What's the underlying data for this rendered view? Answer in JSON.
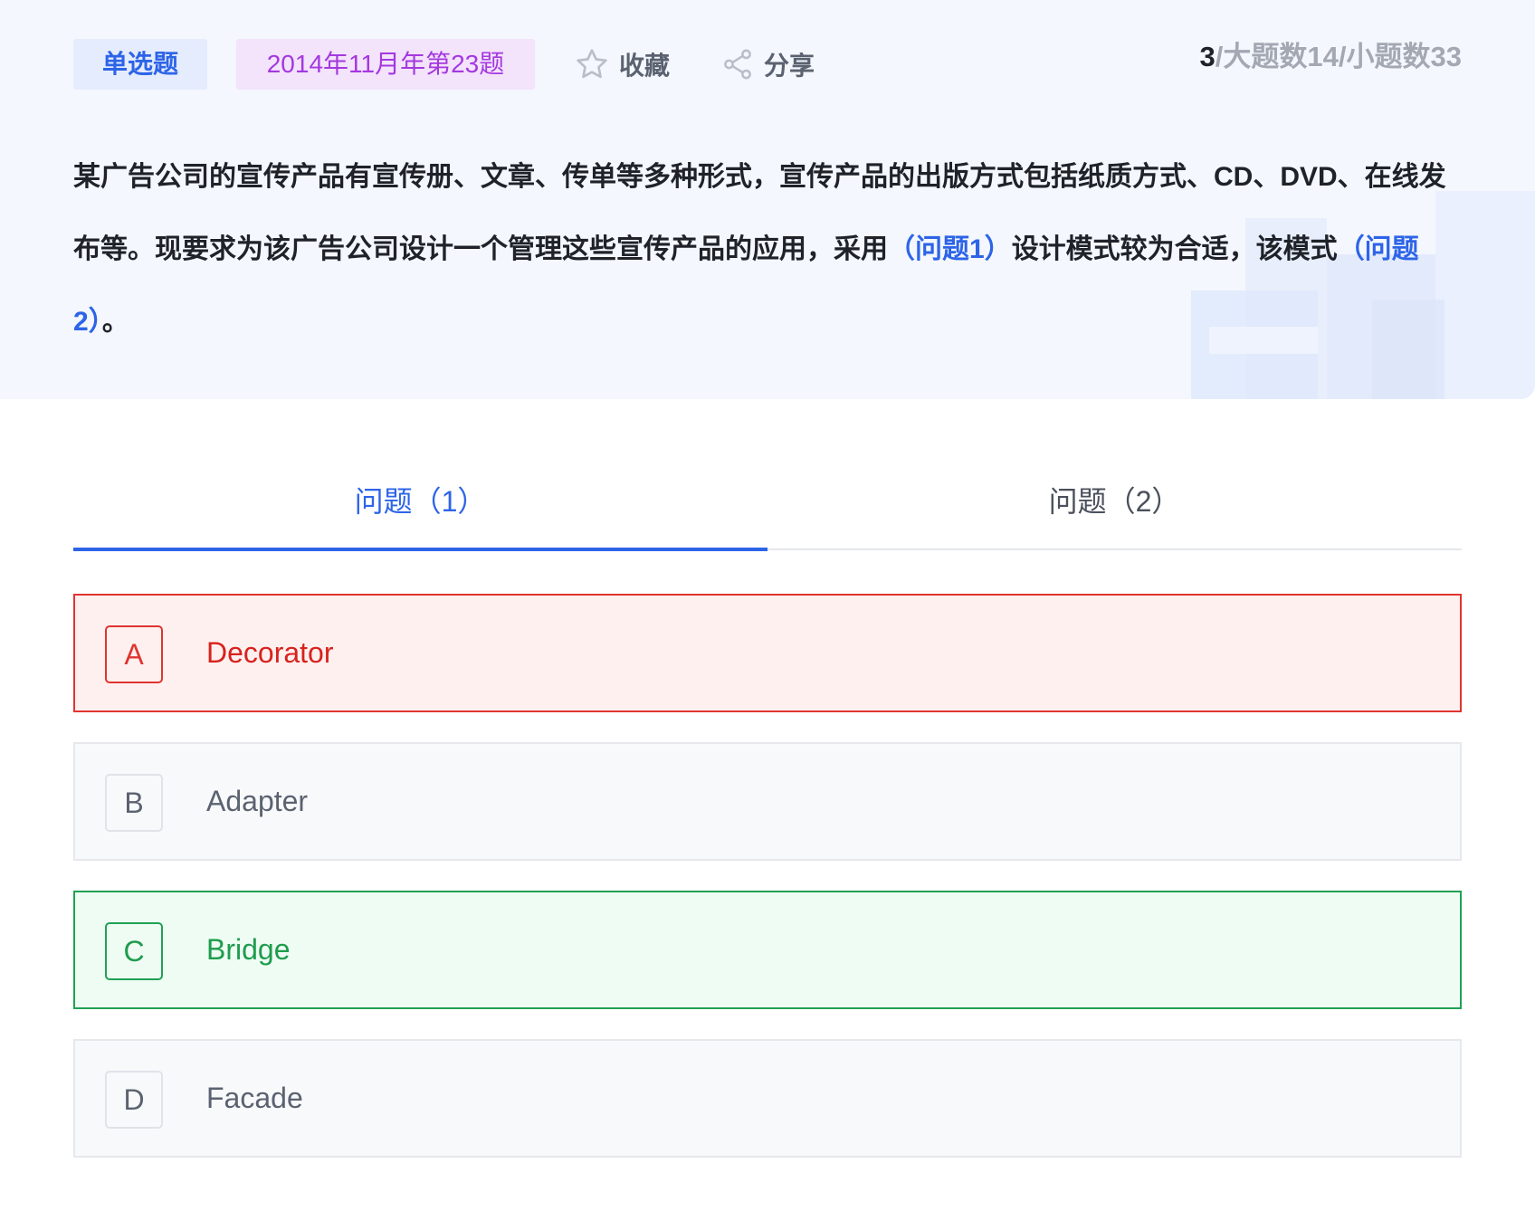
{
  "header": {
    "type_tag": "单选题",
    "source_tag": "2014年11月年第23题",
    "favorite_label": "收藏",
    "share_label": "分享",
    "counter_current": "3",
    "counter_rest": "/大题数14/小题数33"
  },
  "stem": {
    "part1": "某广告公司的宣传产品有宣传册、文章、传单等多种形式，宣传产品的出版方式包括纸质方式、CD、DVD、在线发布等。现要求为该广告公司设计一个管理这些宣传产品的应用，采用",
    "blank1": "（问题1）",
    "part2": "设计模式较为合适，该模式",
    "blank2": "（问题2）",
    "part3": "。"
  },
  "tabs": [
    {
      "label": "问题（1）",
      "active": true
    },
    {
      "label": "问题（2）",
      "active": false
    }
  ],
  "options": [
    {
      "letter": "A",
      "text": "Decorator",
      "state": "wrong"
    },
    {
      "letter": "B",
      "text": "Adapter",
      "state": "normal"
    },
    {
      "letter": "C",
      "text": "Bridge",
      "state": "correct"
    },
    {
      "letter": "D",
      "text": "Facade",
      "state": "normal"
    }
  ],
  "colors": {
    "accent": "#2d64e8",
    "wrong": "#e0342f",
    "correct": "#21a153",
    "source_tag": "#a438e0"
  },
  "icons": [
    "star-icon",
    "share-icon"
  ]
}
